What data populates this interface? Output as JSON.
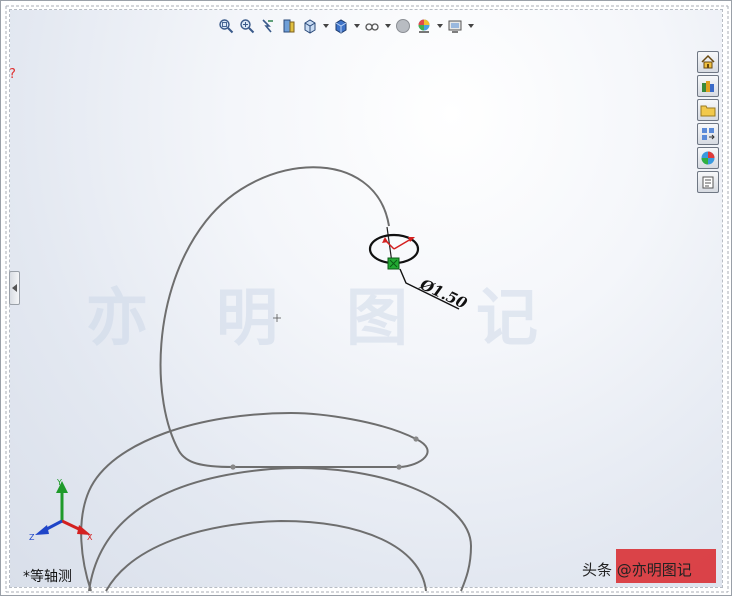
{
  "toolbar": {
    "items": [
      {
        "name": "zoom-to-fit-icon",
        "has_dropdown": false
      },
      {
        "name": "zoom-to-area-icon",
        "has_dropdown": false
      },
      {
        "name": "previous-view-icon",
        "has_dropdown": false
      },
      {
        "name": "section-view-icon",
        "has_dropdown": false
      },
      {
        "name": "view-orientation-icon",
        "has_dropdown": true
      },
      {
        "name": "display-style-icon",
        "has_dropdown": true
      },
      {
        "name": "hide-show-items-icon",
        "has_dropdown": true
      },
      {
        "name": "edit-appearance-icon",
        "has_dropdown": false
      },
      {
        "name": "apply-scene-icon",
        "has_dropdown": true
      },
      {
        "name": "view-settings-icon",
        "has_dropdown": true
      }
    ]
  },
  "taskpane": {
    "items": [
      "home-icon",
      "design-library-icon",
      "file-explorer-icon",
      "view-palette-icon",
      "appearances-icon",
      "custom-properties-icon"
    ]
  },
  "dimension": {
    "text": "Ø1.50"
  },
  "watermark": {
    "chars": [
      "亦",
      "明",
      "图",
      "记"
    ]
  },
  "triad": {
    "x": "X",
    "y": "Y",
    "z": "Z"
  },
  "view": {
    "label": "*等轴测"
  },
  "credit": {
    "text": "头条 @亦明图记"
  },
  "colors": {
    "curve": "#6e6e6e",
    "triad_x": "#d42020",
    "triad_y": "#1f9a2a",
    "triad_z": "#1f45c8",
    "relation_marker": "#22aa33",
    "stamp": "#d8262a"
  }
}
